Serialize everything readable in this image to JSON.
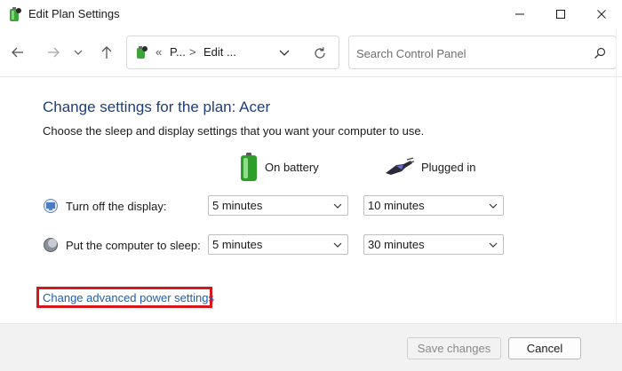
{
  "window": {
    "title": "Edit Plan Settings"
  },
  "nav": {
    "address": {
      "chevron": "«",
      "segment1": "P...",
      "separator": ">",
      "segment2": "Edit ..."
    },
    "search": {
      "placeholder": "Search Control Panel"
    }
  },
  "content": {
    "heading": "Change settings for the plan: Acer",
    "subtext": "Choose the sleep and display settings that you want your computer to use.",
    "columns": {
      "battery": "On battery",
      "plugged": "Plugged in"
    },
    "rows": [
      {
        "label": "Turn off the display:",
        "battery_value": "5 minutes",
        "plugged_value": "10 minutes"
      },
      {
        "label": "Put the computer to sleep:",
        "battery_value": "5 minutes",
        "plugged_value": "30 minutes"
      }
    ],
    "advanced_link": "Change advanced power settings"
  },
  "footer": {
    "save_label": "Save changes",
    "cancel_label": "Cancel"
  },
  "colors": {
    "heading": "#1f3d7a",
    "link": "#1a5fb4",
    "highlight_box": "#d8171d",
    "footer_bg": "#f2f2f2"
  },
  "icons": [
    "app-plan-icon",
    "minimize-icon",
    "maximize-icon",
    "close-icon",
    "back-arrow-icon",
    "forward-arrow-icon",
    "recent-dropdown-icon",
    "up-arrow-icon",
    "address-plan-icon",
    "address-dropdown-icon",
    "refresh-icon",
    "search-icon",
    "battery-icon",
    "plug-icon",
    "display-icon",
    "sleep-moon-icon"
  ]
}
